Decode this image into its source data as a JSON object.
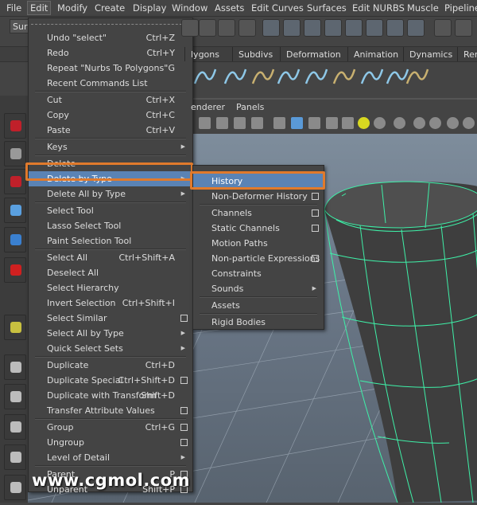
{
  "menubar": [
    "File",
    "Edit",
    "Modify",
    "Create",
    "Display",
    "Window",
    "Assets",
    "Edit Curves",
    "Surfaces",
    "Edit NURBS",
    "Muscle",
    "Pipeline C"
  ],
  "toolbar": {
    "mode_dropdown": "Sur"
  },
  "shelf_tabs": [
    "lygons",
    "Subdivs",
    "Deformation",
    "Animation",
    "Dynamics",
    "Ren"
  ],
  "panel_menu": [
    "enderer",
    "Panels"
  ],
  "edit_menu": [
    {
      "label": "Undo \"select\"",
      "shortcut": "Ctrl+Z"
    },
    {
      "label": "Redo",
      "shortcut": "Ctrl+Y"
    },
    {
      "label": "Repeat \"Nurbs To Polygons\"",
      "shortcut": "G"
    },
    {
      "label": "Recent Commands List"
    },
    {
      "separator": true
    },
    {
      "label": "Cut",
      "shortcut": "Ctrl+X"
    },
    {
      "label": "Copy",
      "shortcut": "Ctrl+C"
    },
    {
      "label": "Paste",
      "shortcut": "Ctrl+V"
    },
    {
      "separator": true
    },
    {
      "label": "Keys",
      "submenu": true
    },
    {
      "separator": true
    },
    {
      "label": "Delete"
    },
    {
      "label": "Delete by Type",
      "submenu": true,
      "highlighted": true
    },
    {
      "label": "Delete All by Type",
      "submenu": true
    },
    {
      "separator": true
    },
    {
      "label": "Select Tool"
    },
    {
      "label": "Lasso Select Tool"
    },
    {
      "label": "Paint Selection Tool"
    },
    {
      "separator": true
    },
    {
      "label": "Select All",
      "shortcut": "Ctrl+Shift+A"
    },
    {
      "label": "Deselect All"
    },
    {
      "label": "Select Hierarchy"
    },
    {
      "label": "Invert Selection",
      "shortcut": "Ctrl+Shift+I"
    },
    {
      "label": "Select Similar",
      "option": true
    },
    {
      "label": "Select All by Type",
      "submenu": true
    },
    {
      "label": "Quick Select Sets",
      "submenu": true
    },
    {
      "separator": true
    },
    {
      "label": "Duplicate",
      "shortcut": "Ctrl+D"
    },
    {
      "label": "Duplicate Special",
      "shortcut": "Ctrl+Shift+D",
      "option": true
    },
    {
      "label": "Duplicate with Transform",
      "shortcut": "Shift+D"
    },
    {
      "label": "Transfer Attribute Values",
      "option": true
    },
    {
      "separator": true
    },
    {
      "label": "Group",
      "shortcut": "Ctrl+G",
      "option": true
    },
    {
      "label": "Ungroup",
      "option": true
    },
    {
      "label": "Level of Detail",
      "submenu": true
    },
    {
      "separator": true
    },
    {
      "label": "Parent",
      "shortcut": "P",
      "option": true
    },
    {
      "label": "Unparent",
      "shortcut": "Shift+P",
      "option": true
    }
  ],
  "delete_by_type_menu": [
    {
      "label": "History",
      "highlighted": true
    },
    {
      "label": "Non-Deformer History",
      "option": true
    },
    {
      "separator": true
    },
    {
      "label": "Channels",
      "option": true
    },
    {
      "label": "Static Channels",
      "option": true
    },
    {
      "label": "Motion Paths"
    },
    {
      "label": "Non-particle Expressions",
      "option": true
    },
    {
      "label": "Constraints"
    },
    {
      "label": "Sounds",
      "submenu": true
    },
    {
      "separator": true
    },
    {
      "label": "Assets"
    },
    {
      "separator": true
    },
    {
      "label": "Rigid Bodies"
    }
  ],
  "colors": {
    "highlight": "#5a83b5",
    "annotation": "#e07a2c",
    "wireframe": "#3ef0a8"
  },
  "watermark": "www.cgmol.com"
}
